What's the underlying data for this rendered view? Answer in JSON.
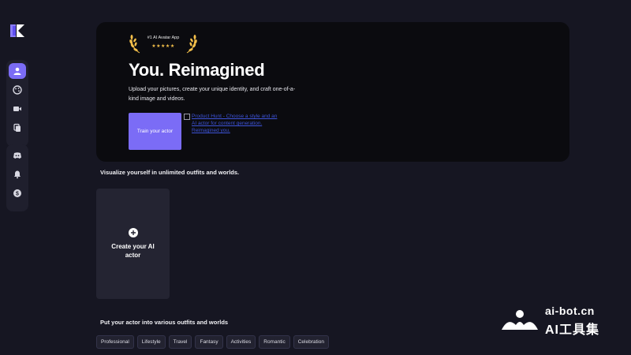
{
  "colors": {
    "background": "#161622",
    "hero_background": "#0b0b0f",
    "accent": "#7b6cf6",
    "gold": "#f5c04a",
    "card": "#242432",
    "link": "#3d53d8"
  },
  "sidebar": {
    "logo_icon": "brand-logo-icon",
    "primary": [
      {
        "icon": "user-icon",
        "active": true
      },
      {
        "icon": "palette-icon",
        "active": false
      },
      {
        "icon": "video-camera-icon",
        "active": false
      },
      {
        "icon": "copy-icon",
        "active": false
      }
    ],
    "secondary": [
      {
        "icon": "discord-icon"
      },
      {
        "icon": "bell-icon"
      },
      {
        "icon": "dollar-icon"
      }
    ]
  },
  "hero": {
    "badge_text": "#1 AI Avatar App",
    "badge_stars": "★★★★★",
    "title": "You. Reimagined",
    "subtitle": "Upload your pictures, create your unique identity, and craft one-of-a-kind image and videos.",
    "train_button": "Train your actor",
    "broken_image_alt": "Product Hunt - Choose a style and an AI actor for content generation. Reimagined you."
  },
  "section1": {
    "heading": "Visualize yourself in unlimited outfits and worlds.",
    "create_card_label": "Create your AI actor"
  },
  "section2": {
    "heading": "Put your actor into various outfits and worlds",
    "tags": [
      "Professional",
      "Lifestyle",
      "Travel",
      "Fantasy",
      "Activities",
      "Romantic",
      "Celebration"
    ]
  },
  "watermark": {
    "line1": "ai-bot.cn",
    "line2": "AI工具集"
  }
}
